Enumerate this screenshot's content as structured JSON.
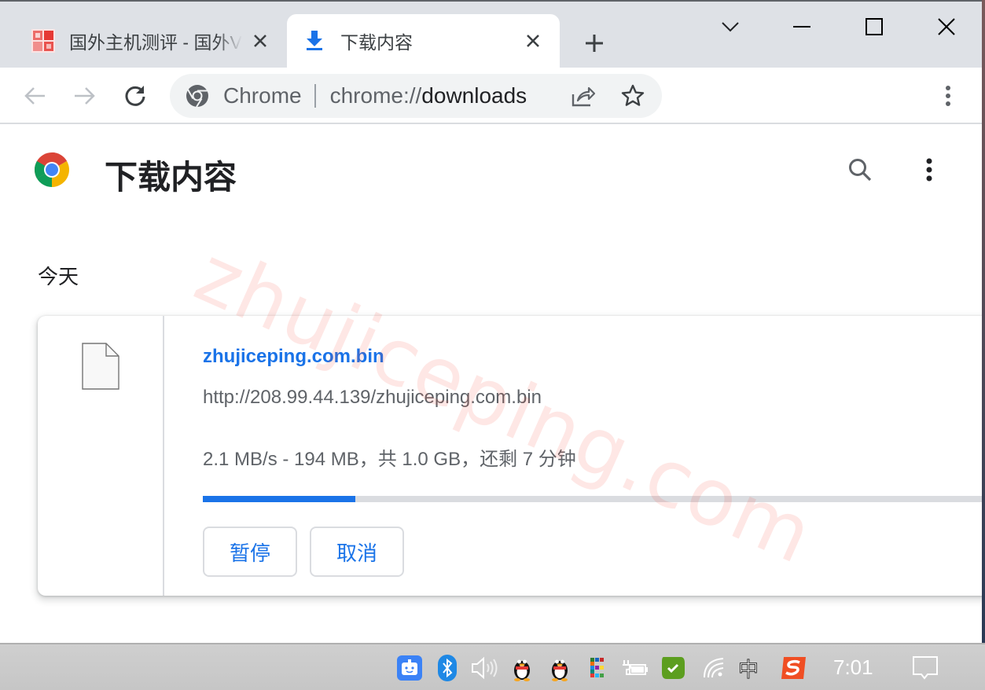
{
  "tabs": [
    {
      "title": "国外主机测评 - 国外VPS",
      "active": false,
      "favicon": "site-logo-icon"
    },
    {
      "title": "下载内容",
      "active": true,
      "favicon": "download-icon"
    }
  ],
  "window_controls": [
    "tab-search-icon",
    "minimize-icon",
    "maximize-icon",
    "close-icon"
  ],
  "omnibox": {
    "site_label": "Chrome",
    "url_scheme": "chrome://",
    "url_path": "downloads"
  },
  "page": {
    "title": "下载内容",
    "section_date": "今天"
  },
  "download": {
    "file_name": "zhujiceping.com.bin",
    "url": "http://208.99.44.139/zhujiceping.com.bin",
    "status": "2.1 MB/s - 194 MB，共 1.0 GB，还剩 7 分钟",
    "progress_percent": 19,
    "pause_label": "暂停",
    "cancel_label": "取消"
  },
  "watermark": "zhujiceping.com",
  "colors": {
    "accent": "#1a73e8",
    "tabstrip_bg": "#dee1e6",
    "text_primary": "#202124",
    "text_secondary": "#5f6368"
  },
  "taskbar": {
    "tray_icons": [
      "assistant-icon",
      "bluetooth-icon",
      "volume-icon",
      "qq-icon",
      "qq-icon",
      "color-grid-icon",
      "battery-charging-icon",
      "wechat-check-icon",
      "wifi-icon",
      "ime-zh-icon",
      "sogou-icon"
    ],
    "ime_label": "中",
    "clock": "7:01",
    "notification_icon": "action-center-icon"
  }
}
